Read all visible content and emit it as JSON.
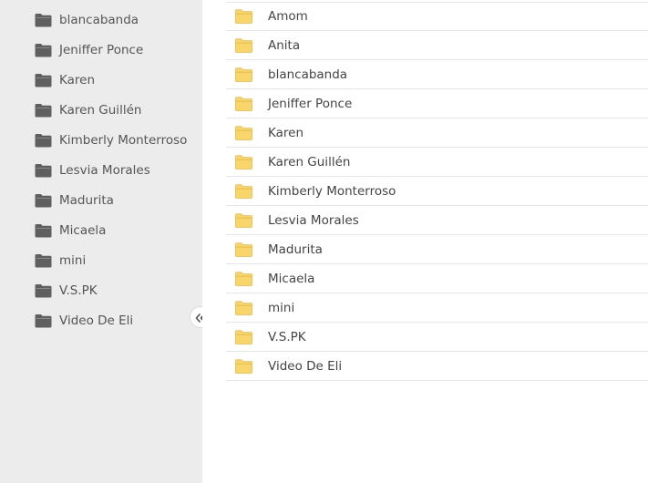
{
  "sidebar": {
    "items": [
      {
        "label": "blancabanda",
        "icon": "folder-icon"
      },
      {
        "label": "Jeniffer Ponce",
        "icon": "folder-icon"
      },
      {
        "label": "Karen",
        "icon": "folder-icon"
      },
      {
        "label": "Karen Guillén",
        "icon": "folder-icon"
      },
      {
        "label": "Kimberly Monterroso",
        "icon": "folder-icon"
      },
      {
        "label": "Lesvia Morales",
        "icon": "folder-icon"
      },
      {
        "label": "Madurita",
        "icon": "folder-icon"
      },
      {
        "label": "Micaela",
        "icon": "folder-icon"
      },
      {
        "label": "mini",
        "icon": "folder-icon"
      },
      {
        "label": "V.S.PK",
        "icon": "folder-icon"
      },
      {
        "label": "Video De Eli",
        "icon": "folder-icon"
      }
    ],
    "folder_color": "#5f5f5f",
    "collapse_icon": "double-chevron-left-icon"
  },
  "main": {
    "files": [
      {
        "name": "Amom",
        "icon": "folder-icon"
      },
      {
        "name": "Anita",
        "icon": "folder-icon"
      },
      {
        "name": "blancabanda",
        "icon": "folder-icon"
      },
      {
        "name": "Jeniffer Ponce",
        "icon": "folder-icon"
      },
      {
        "name": "Karen",
        "icon": "folder-icon"
      },
      {
        "name": "Karen Guillén",
        "icon": "folder-icon"
      },
      {
        "name": "Kimberly Monterroso",
        "icon": "folder-icon"
      },
      {
        "name": "Lesvia Morales",
        "icon": "folder-icon"
      },
      {
        "name": "Madurita",
        "icon": "folder-icon"
      },
      {
        "name": "Micaela",
        "icon": "folder-icon"
      },
      {
        "name": "mini",
        "icon": "folder-icon"
      },
      {
        "name": "V.S.PK",
        "icon": "folder-icon"
      },
      {
        "name": "Video De Eli",
        "icon": "folder-icon"
      }
    ],
    "folder_color": "#f9d66b",
    "folder_outline": "#e8b84a"
  }
}
